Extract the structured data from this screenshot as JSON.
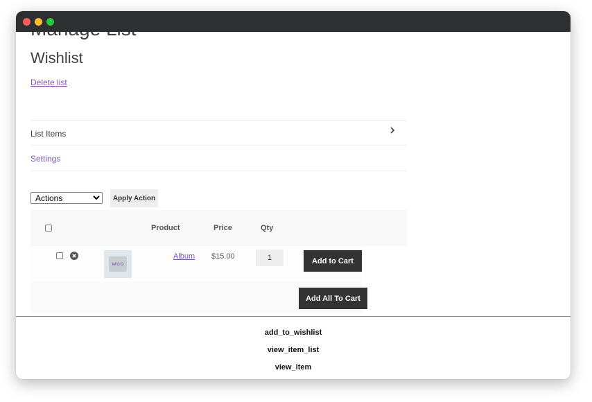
{
  "page": {
    "clipped_heading": "Manage List",
    "wishlist_title": "Wishlist",
    "delete_link": "Delete list"
  },
  "tabs": [
    {
      "label": "List Items",
      "icon": "chevron-right-icon"
    },
    {
      "label": "Settings"
    }
  ],
  "actions": {
    "selected": "Actions",
    "apply_label": "Apply Action"
  },
  "table": {
    "columns": [
      "Product",
      "Price",
      "Qty"
    ],
    "rows": [
      {
        "product": "Album",
        "price": "$15.00",
        "qty": "1",
        "add_label": "Add to Cart",
        "thumb_text": "WOO"
      }
    ],
    "add_all_label": "Add All To Cart"
  },
  "events": [
    "add_to_wishlist",
    "view_item_list",
    "view_item"
  ],
  "colors": {
    "link": "#7f54b3",
    "button_dark": "#333333",
    "titlebar": "#2d2f31"
  }
}
